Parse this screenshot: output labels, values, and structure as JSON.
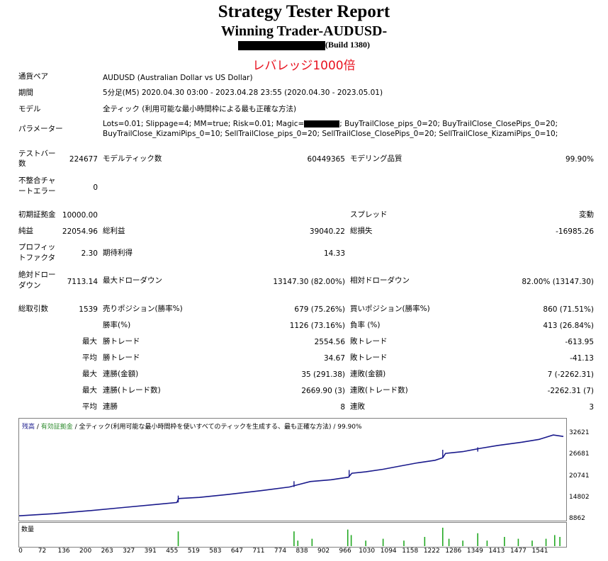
{
  "header": {
    "title": "Strategy Tester Report",
    "subtitle": "Winning Trader-AUDUSD-",
    "build": "(Build 1380)",
    "leverage": "レバレッジ1000倍"
  },
  "info": {
    "pair_label": "通貨ペア",
    "pair_value": "AUDUSD (Australian Dollar vs US Dollar)",
    "period_label": "期間",
    "period_value": "5分足(M5) 2020.04.30 03:00 - 2023.04.28 23:55 (2020.04.30 - 2023.05.01)",
    "model_label": "モデル",
    "model_value": "全ティック (利用可能な最小時間枠による最も正確な方法)",
    "params_label": "パラメーター",
    "params_line1_a": "Lots=0.01; Slippage=4; MM=true; Risk=0.01; Magic=",
    "params_line1_b": "; BuyTrailClose_pips_0=20; BuyTrailClose_ClosePips_0=20;",
    "params_line2": "BuyTrailClose_KizamiPips_0=10; SellTrailClose_pips_0=20; SellTrailClose_ClosePips_0=20; SellTrailClose_KizamiPips_0=10;"
  },
  "stats": {
    "bars_label_1": "テストバー",
    "bars_label_2": "数",
    "bars_value": "224677",
    "ticks_label": "モデルティック数",
    "ticks_value": "60449365",
    "quality_label": "モデリング品質",
    "quality_value": "99.90%",
    "mismatch_label_1": "不整合チャ",
    "mismatch_label_2": "ートエラー",
    "mismatch_value": "0",
    "deposit_label": "初期証拠金",
    "deposit_value": "10000.00",
    "spread_label": "スプレッド",
    "spread_value": "変動",
    "net_label": "純益",
    "net_value": "22054.96",
    "gross_profit_label": "総利益",
    "gross_profit_value": "39040.22",
    "gross_loss_label": "総損失",
    "gross_loss_value": "-16985.26",
    "pf_label_1": "プロフィッ",
    "pf_label_2": "トファクタ",
    "pf_value": "2.30",
    "expected_label": "期待利得",
    "expected_value": "14.33",
    "abs_dd_label_1": "絶対ドロー",
    "abs_dd_label_2": "ダウン",
    "abs_dd_value": "7113.14",
    "max_dd_label": "最大ドローダウン",
    "max_dd_value": "13147.30 (82.00%)",
    "rel_dd_label": "相対ドローダウン",
    "rel_dd_value": "82.00% (13147.30)",
    "total_label": "総取引数",
    "total_value": "1539",
    "short_label": "売りポジション(勝率%)",
    "short_value": "679 (75.26%)",
    "long_label": "買いポジション(勝率%)",
    "long_value": "860 (71.51%)",
    "win_rate_label": "勝率(%)",
    "win_rate_value": "1126 (73.16%)",
    "loss_rate_label": "負率 (%)",
    "loss_rate_value": "413 (26.84%)",
    "max_label": "最大",
    "avg_label": "平均",
    "win_trade_label": "勝トレード",
    "loss_trade_label": "敗トレード",
    "max_win_value": "2554.56",
    "max_loss_value": "-613.95",
    "avg_win_value": "34.67",
    "avg_loss_value": "-41.13",
    "cons_win_money_label": "連勝(金額)",
    "cons_win_money_value": "35 (291.38)",
    "cons_loss_money_label": "連敗(金額)",
    "cons_loss_money_value": "7 (-2262.31)",
    "cons_win_count_label": "連勝(トレード数)",
    "cons_win_count_value": "2669.90 (3)",
    "cons_loss_count_label": "連敗(トレード数)",
    "cons_loss_count_value": "-2262.31 (7)",
    "avg_cons_win_label": "連勝",
    "avg_cons_win_value": "8",
    "avg_cons_loss_label": "連敗",
    "avg_cons_loss_value": "3"
  },
  "chart_data": {
    "type": "line",
    "legend_balance": "残高",
    "legend_equity": "有効証拠金",
    "legend_rest": " / 全ティック(利用可能な最小時間枠を使いすべてのティックを生成する、最も正確な方法) / 99.90%",
    "volume_label": "数量",
    "yticks": [
      "32621",
      "26681",
      "20741",
      "14802",
      "8862"
    ],
    "ytick_values": [
      32621,
      26681,
      20741,
      14802,
      8862
    ],
    "ylim": [
      8862,
      34000
    ],
    "xticks": [
      "0",
      "72",
      "136",
      "200",
      "263",
      "327",
      "391",
      "455",
      "519",
      "583",
      "647",
      "711",
      "774",
      "838",
      "902",
      "966",
      "1030",
      "1094",
      "1158",
      "1222",
      "1286",
      "1349",
      "1413",
      "1477",
      "1541"
    ],
    "xlim": [
      0,
      1570
    ],
    "balance_x": [
      0,
      100,
      200,
      300,
      400,
      455,
      460,
      520,
      600,
      700,
      780,
      800,
      840,
      900,
      950,
      960,
      1000,
      1050,
      1100,
      1150,
      1200,
      1222,
      1230,
      1280,
      1330,
      1380,
      1450,
      1500,
      1541,
      1570
    ],
    "balance_y": [
      10000,
      10600,
      11400,
      12300,
      13200,
      13700,
      14800,
      15100,
      15900,
      17000,
      18000,
      18500,
      19500,
      20000,
      20700,
      21800,
      22200,
      22900,
      23800,
      24700,
      25400,
      26100,
      27300,
      27800,
      28700,
      29500,
      30400,
      31200,
      32400,
      32000
    ],
    "spikes_x": [
      459,
      793,
      952,
      1222,
      1323
    ],
    "spikes_y": [
      15600,
      19600,
      22700,
      28300,
      29000
    ],
    "volume_x": [
      459,
      793,
      804,
      845,
      948,
      958,
      1000,
      1050,
      1110,
      1170,
      1222,
      1240,
      1280,
      1323,
      1350,
      1400,
      1440,
      1480,
      1520,
      1545,
      1560
    ],
    "volume_v": [
      0.8,
      0.8,
      0.3,
      0.4,
      0.9,
      0.6,
      0.3,
      0.4,
      0.3,
      0.5,
      1.0,
      0.4,
      0.3,
      0.7,
      0.3,
      0.5,
      0.4,
      0.3,
      0.4,
      0.6,
      0.5
    ]
  }
}
